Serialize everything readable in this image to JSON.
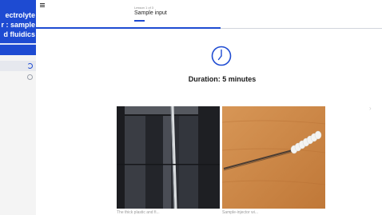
{
  "sidebar": {
    "course_title": "ectrolyte\nr : sample\nd fluidics",
    "lessons": [
      {
        "status": "in-progress"
      },
      {
        "status": "not-started"
      }
    ]
  },
  "header": {
    "lesson_count": "Lesson 1 of 3",
    "lesson_title": "Sample input",
    "menu_icon": "hamburger-menu-icon"
  },
  "main": {
    "clock_icon": "clock-icon",
    "duration_text": "Duration: 5 minutes",
    "images": [
      {
        "caption": "The thick plastic and fi..."
      },
      {
        "caption": "Sample-injector wi..."
      }
    ]
  },
  "colors": {
    "accent": "#1e4bd2",
    "sidebar_bg": "#f4f4f4"
  }
}
